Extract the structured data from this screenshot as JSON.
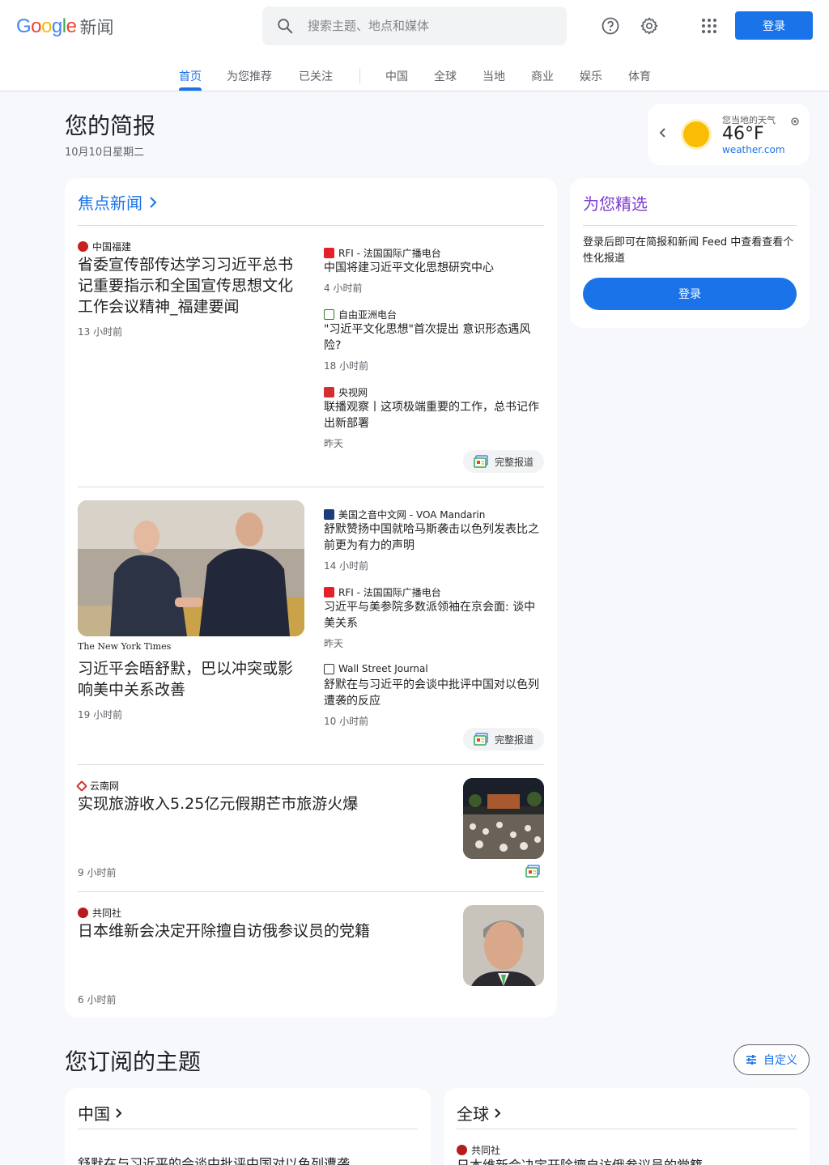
{
  "header": {
    "logo_google": "Google",
    "logo_news": "新闻",
    "search_placeholder": "搜索主题、地点和媒体",
    "signin_label": "登录"
  },
  "tabs": [
    {
      "label": "首页",
      "active": true
    },
    {
      "label": "为您推荐"
    },
    {
      "label": "已关注"
    },
    {
      "label": "中国"
    },
    {
      "label": "全球"
    },
    {
      "label": "当地"
    },
    {
      "label": "商业"
    },
    {
      "label": "娱乐"
    },
    {
      "label": "体育"
    }
  ],
  "briefing": {
    "title": "您的简报",
    "date": "10月10日星期二"
  },
  "weather": {
    "location_label": "您当地的天气",
    "temp": "46°F",
    "source": "weather.com"
  },
  "top_stories": {
    "title": "焦点新闻",
    "full_coverage_label": "完整报道",
    "cluster1": {
      "main": {
        "source": "中国福建",
        "headline": "省委宣传部传达学习习近平总书记重要指示和全国宣传思想文化工作会议精神_福建要闻",
        "time": "13 小时前"
      },
      "side": [
        {
          "source": "RFI - 法国国际广播电台",
          "headline": "中国将建习近平文化思想研究中心",
          "time": "4 小时前"
        },
        {
          "source": "自由亚洲电台",
          "headline": "\"习近平文化思想\"首次提出 意识形态遇风险?",
          "time": "18 小时前"
        },
        {
          "source": "央视网",
          "headline": "联播观察丨这项极端重要的工作，总书记作出新部署",
          "time": "昨天"
        }
      ]
    },
    "cluster2": {
      "main": {
        "source": "The New York Times",
        "headline": "习近平会晤舒默，巴以冲突或影响美中关系改善",
        "time": "19 小时前"
      },
      "side": [
        {
          "source": "美国之音中文网 - VOA Mandarin",
          "headline": "舒默赞扬中国就哈马斯袭击以色列发表比之前更为有力的声明",
          "time": "14 小时前"
        },
        {
          "source": "RFI - 法国国际广播电台",
          "headline": "习近平与美参院多数派领袖在京会面: 谈中美关系",
          "time": "昨天"
        },
        {
          "source": "Wall Street Journal",
          "headline": "舒默在与习近平的会谈中批评中国对以色列遭袭的反应",
          "time": "10 小时前"
        }
      ]
    },
    "story3": {
      "source": "云南网",
      "headline": "实现旅游收入5.25亿元假期芒市旅游火爆",
      "time": "9 小时前"
    },
    "story4": {
      "source": "共同社",
      "headline": "日本维新会决定开除擅自访俄参议员的党籍",
      "time": "6 小时前"
    }
  },
  "picks": {
    "title": "为您精选",
    "text": "登录后即可在简报和新闻 Feed 中查看查看个性化报道",
    "button": "登录"
  },
  "topics": {
    "title": "您订阅的主题",
    "customize": "自定义",
    "china": {
      "title": "中国",
      "headline": "舒默在与习近平的会谈中批评中国对以色列遭袭"
    },
    "world": {
      "title": "全球",
      "source": "共同社",
      "headline": "日本维新会决定开除擅自访俄参议员的党籍"
    }
  },
  "colors": {
    "accent": "#1a73e8",
    "picks_accent": "#7b3ccf"
  }
}
